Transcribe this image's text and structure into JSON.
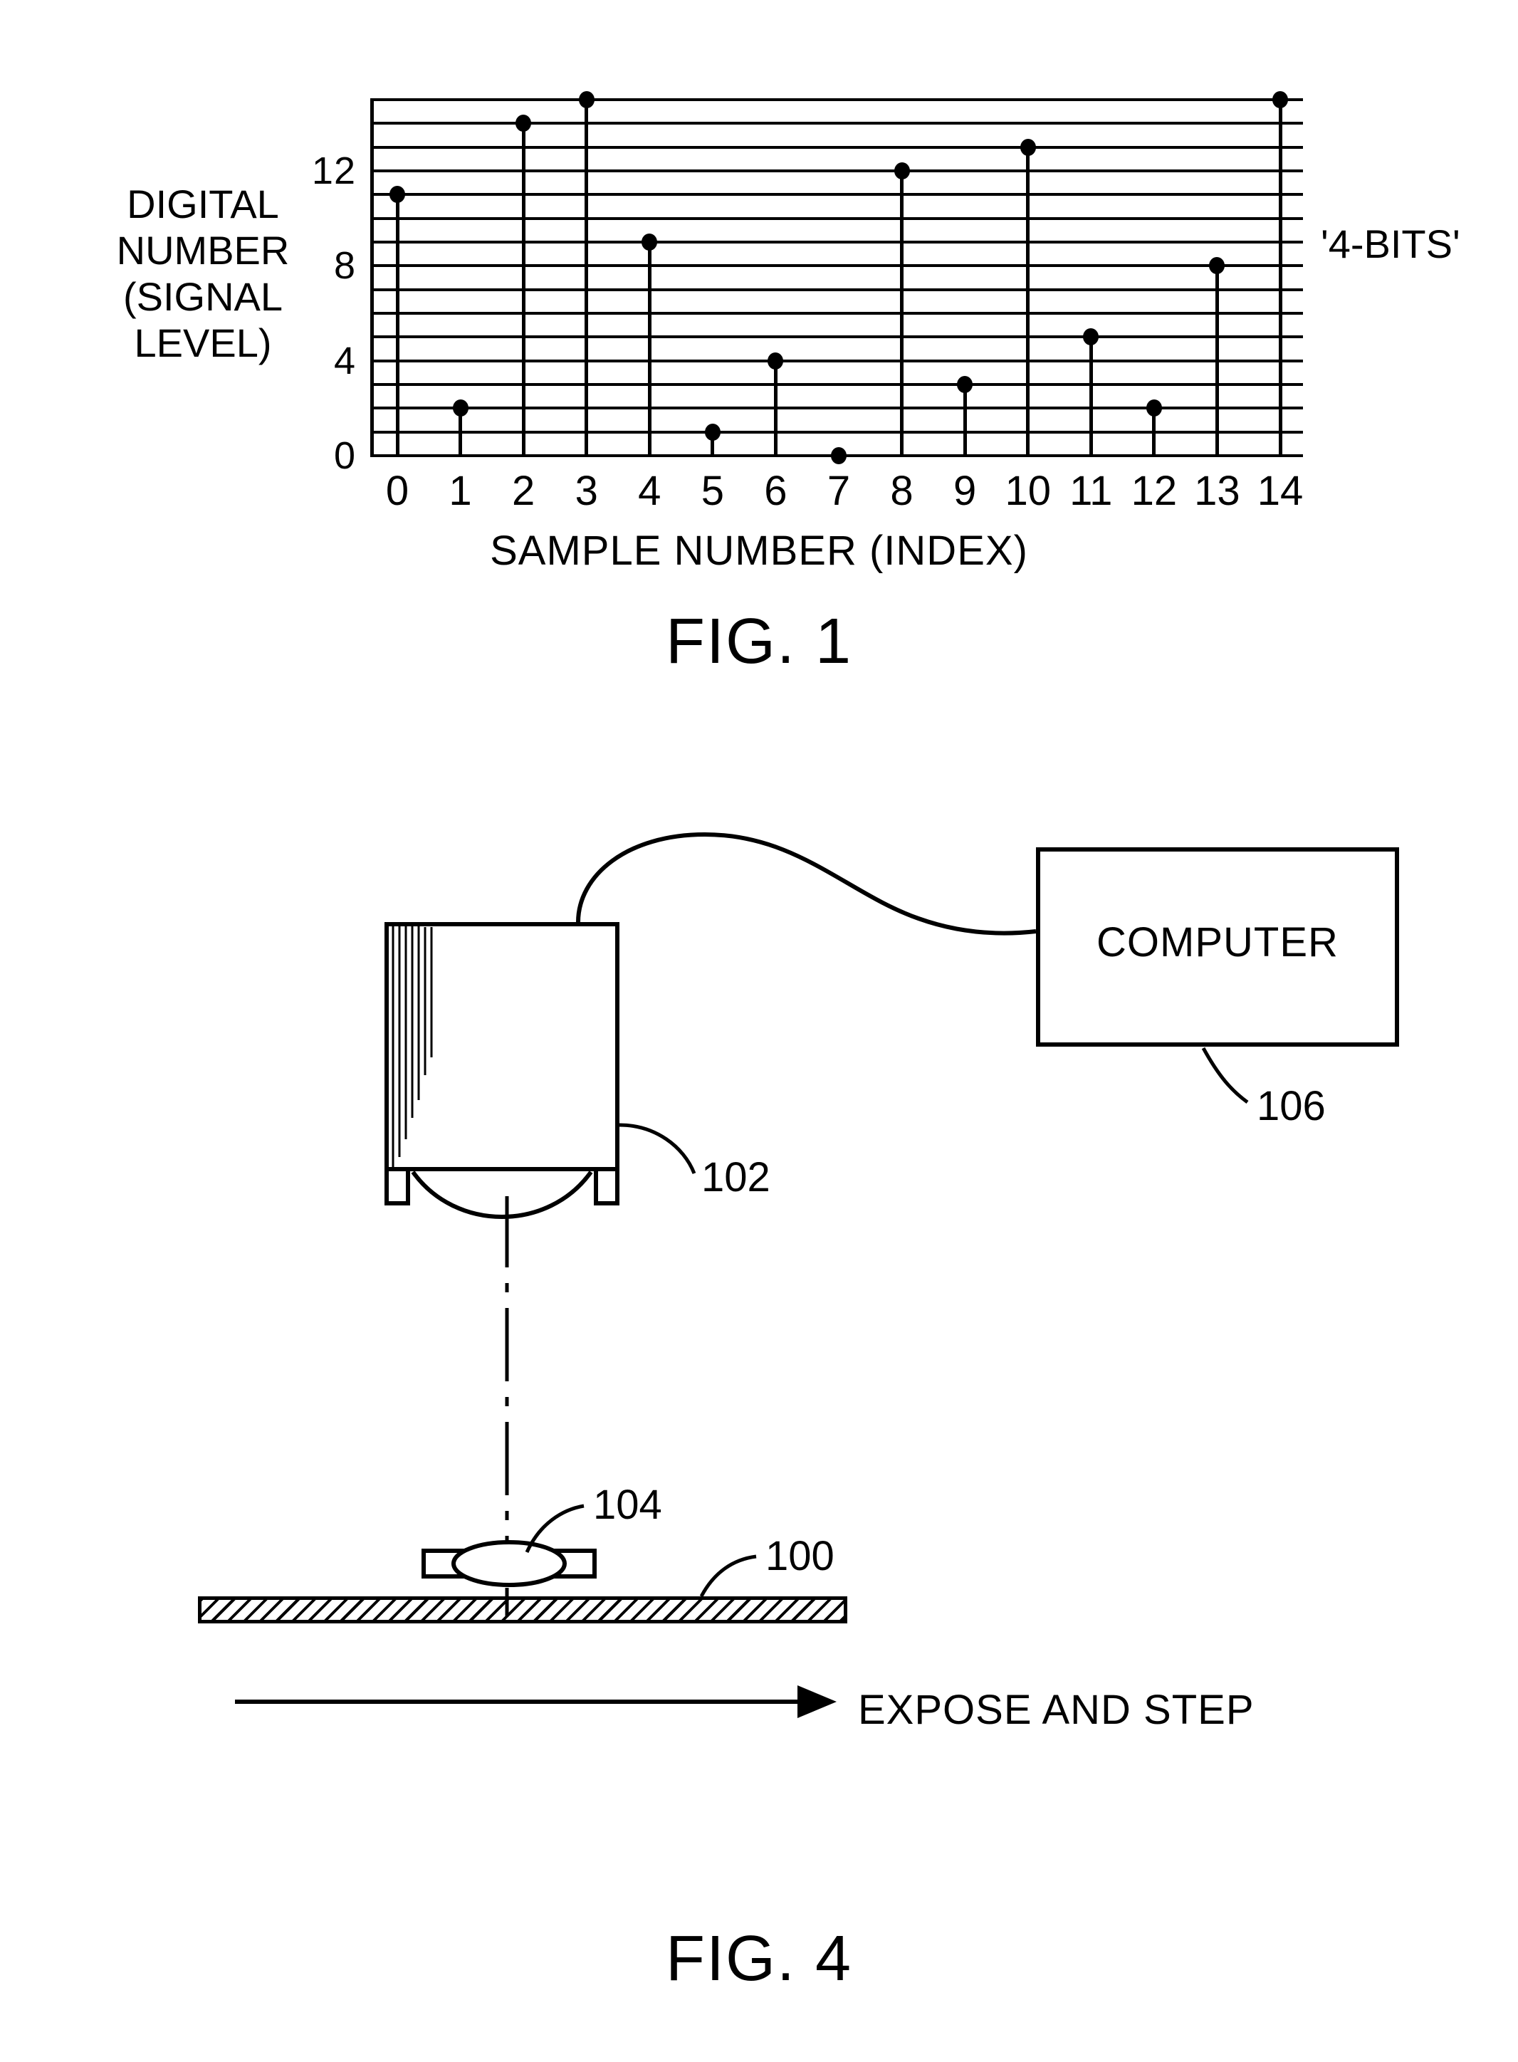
{
  "figure1": {
    "caption": "FIG. 1",
    "y_axis_label": "DIGITAL\nNUMBER\n(SIGNAL\nLEVEL)",
    "x_axis_label": "SAMPLE NUMBER (INDEX)",
    "annotation": "'4-BITS'",
    "y_ticks": [
      "0",
      "4",
      "8",
      "12"
    ],
    "x_ticks": [
      "0",
      "1",
      "2",
      "3",
      "4",
      "5",
      "6",
      "7",
      "8",
      "9",
      "10",
      "11",
      "12",
      "13",
      "14"
    ]
  },
  "chart_data": {
    "type": "scatter",
    "title": "FIG. 1",
    "xlabel": "SAMPLE NUMBER (INDEX)",
    "ylabel": "DIGITAL NUMBER (SIGNAL LEVEL)",
    "annotation": "'4-BITS'",
    "x": [
      0,
      1,
      2,
      3,
      4,
      5,
      6,
      7,
      8,
      9,
      10,
      11,
      12,
      13,
      14
    ],
    "values": [
      11,
      2,
      14,
      15,
      9,
      1,
      4,
      0,
      12,
      3,
      13,
      5,
      2,
      8,
      15
    ],
    "categories": [
      "0",
      "1",
      "2",
      "3",
      "4",
      "5",
      "6",
      "7",
      "8",
      "9",
      "10",
      "11",
      "12",
      "13",
      "14"
    ],
    "xlim": [
      0,
      14
    ],
    "ylim": [
      0,
      15
    ],
    "y_tick_values": [
      0,
      4,
      8,
      12
    ],
    "gridlines_y": [
      0,
      1,
      2,
      3,
      4,
      5,
      6,
      7,
      8,
      9,
      10,
      11,
      12,
      13,
      14,
      15
    ],
    "grid": true,
    "legend": false,
    "marker": "filled-circle-with-stem"
  },
  "figure4": {
    "caption": "FIG. 4",
    "computer_label": "COMPUTER",
    "ref_camera": "102",
    "ref_computer": "106",
    "ref_lens": "104",
    "ref_substrate": "100",
    "motion_label": "EXPOSE AND STEP"
  }
}
